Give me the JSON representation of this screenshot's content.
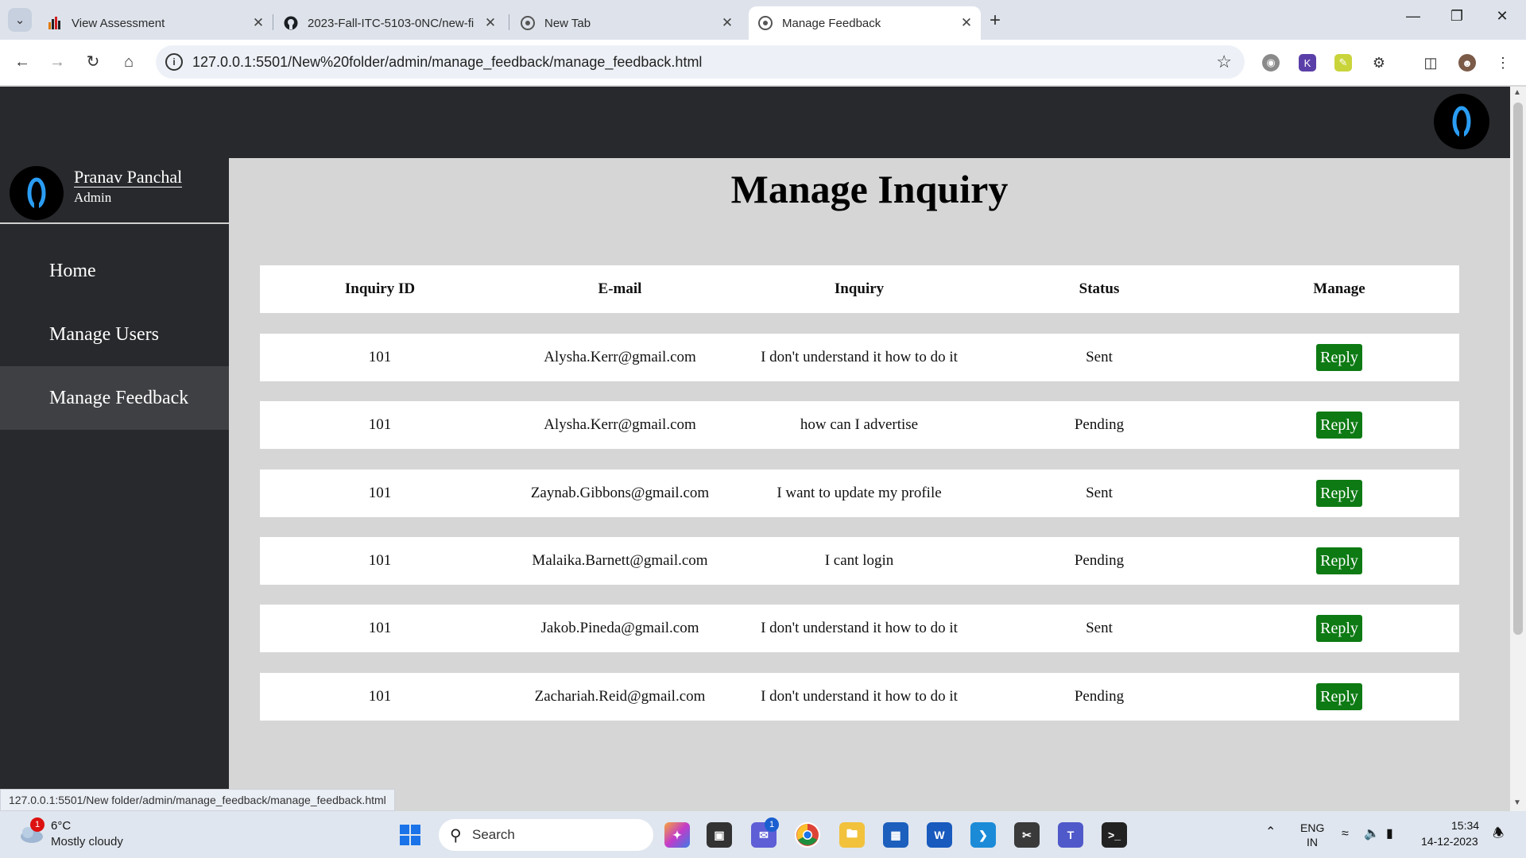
{
  "browser": {
    "tabs": [
      {
        "title": "View Assessment"
      },
      {
        "title": "2023-Fall-ITC-5103-0NC/new-fi"
      },
      {
        "title": "New Tab"
      },
      {
        "title": "Manage Feedback"
      }
    ],
    "url": "127.0.0.1:5501/New%20folder/admin/manage_feedback/manage_feedback.html",
    "status_url": "127.0.0.1:5501/New folder/admin/manage_feedback/manage_feedback.html"
  },
  "sidebar": {
    "profile_name": "Pranav Panchal",
    "profile_role": "Admin",
    "items": [
      {
        "label": "Home"
      },
      {
        "label": "Manage Users"
      },
      {
        "label": "Manage Feedback"
      }
    ]
  },
  "main": {
    "title": "Manage Inquiry",
    "columns": [
      "Inquiry ID",
      "E-mail",
      "Inquiry",
      "Status",
      "Manage"
    ],
    "rows": [
      {
        "id": "101",
        "email": "Alysha.Kerr@gmail.com",
        "inquiry": "I don't understand it how to do it",
        "status": "Sent",
        "action": "Reply"
      },
      {
        "id": "101",
        "email": "Alysha.Kerr@gmail.com",
        "inquiry": "how can I advertise",
        "status": "Pending",
        "action": "Reply"
      },
      {
        "id": "101",
        "email": "Zaynab.Gibbons@gmail.com",
        "inquiry": "I want to update my profile",
        "status": "Sent",
        "action": "Reply"
      },
      {
        "id": "101",
        "email": "Malaika.Barnett@gmail.com",
        "inquiry": "I cant login",
        "status": "Pending",
        "action": "Reply"
      },
      {
        "id": "101",
        "email": "Jakob.Pineda@gmail.com",
        "inquiry": "I don't understand it how to do it",
        "status": "Sent",
        "action": "Reply"
      },
      {
        "id": "101",
        "email": "Zachariah.Reid@gmail.com",
        "inquiry": "I don't understand it how to do it",
        "status": "Pending",
        "action": "Reply"
      }
    ]
  },
  "taskbar": {
    "weather_badge": "1",
    "weather_temp": "6°C",
    "weather_desc": "Mostly cloudy",
    "search_label": "Search",
    "chat_badge": "1",
    "lang_line1": "ENG",
    "lang_line2": "IN",
    "time": "15:34",
    "date": "14-12-2023"
  },
  "colors": {
    "sidebar_bg": "#28292c",
    "content_bg": "#d6d6d6",
    "reply_button": "#0d7a13",
    "active_menu": "#3f4043"
  },
  "icons": [
    "tab-list-icon",
    "chart-favicon",
    "github-favicon",
    "chrome-favicon",
    "back-icon",
    "forward-icon",
    "reload-icon",
    "home-icon",
    "info-icon",
    "star-icon",
    "extensions-icon",
    "avatar-icon",
    "windows-start-icon",
    "search-icon",
    "wifi-icon",
    "volume-icon",
    "battery-icon",
    "bell-icon"
  ]
}
